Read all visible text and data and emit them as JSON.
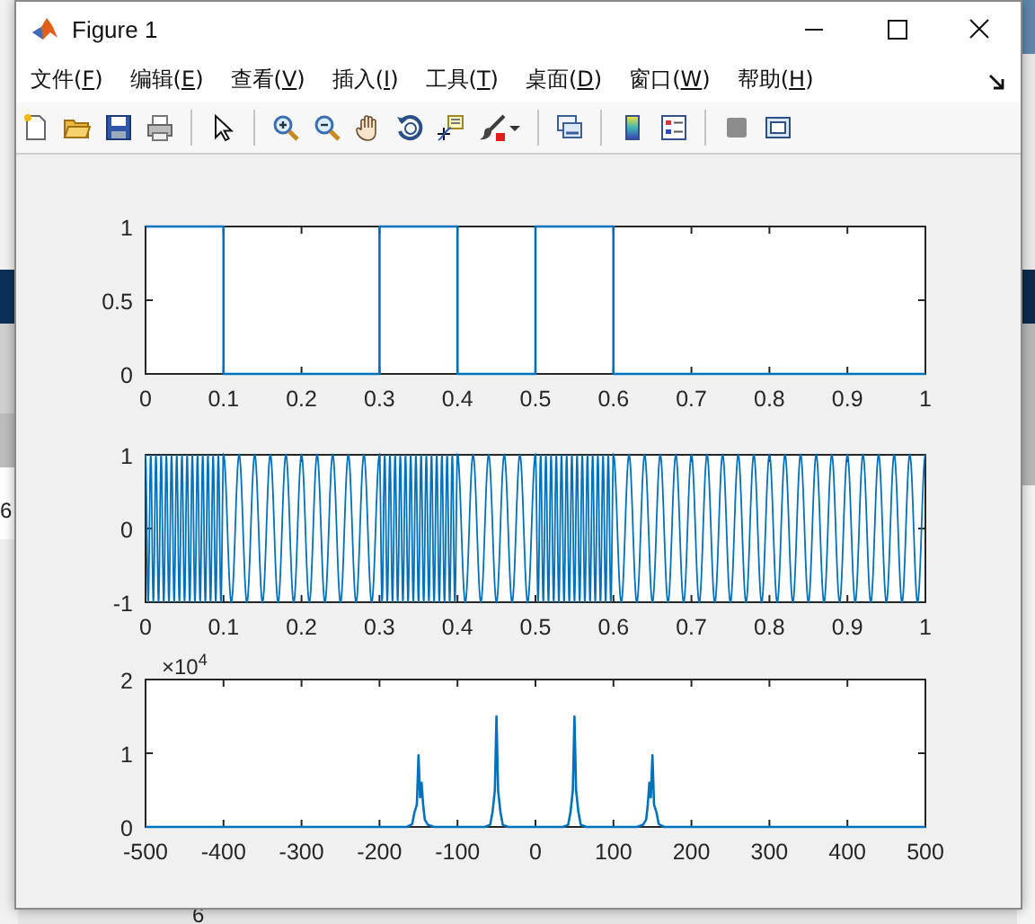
{
  "window": {
    "title": "Figure 1"
  },
  "menu": [
    {
      "parts": [
        {
          "text": "文件("
        },
        {
          "text": "F",
          "underlined": true
        },
        {
          "text": ")"
        }
      ]
    },
    {
      "parts": [
        {
          "text": "编辑("
        },
        {
          "text": "E",
          "underlined": true
        },
        {
          "text": ")"
        }
      ]
    },
    {
      "parts": [
        {
          "text": "查看("
        },
        {
          "text": "V",
          "underlined": true
        },
        {
          "text": ")"
        }
      ]
    },
    {
      "parts": [
        {
          "text": "插入("
        },
        {
          "text": "I",
          "underlined": true
        },
        {
          "text": ")"
        }
      ]
    },
    {
      "parts": [
        {
          "text": "工具("
        },
        {
          "text": "T",
          "underlined": true
        },
        {
          "text": ")"
        }
      ]
    },
    {
      "parts": [
        {
          "text": "桌面("
        },
        {
          "text": "D",
          "underlined": true
        },
        {
          "text": ")"
        }
      ]
    },
    {
      "parts": [
        {
          "text": "窗口("
        },
        {
          "text": "W",
          "underlined": true
        },
        {
          "text": ")"
        }
      ]
    },
    {
      "parts": [
        {
          "text": "帮助("
        },
        {
          "text": "H",
          "underlined": true
        },
        {
          "text": ")"
        }
      ]
    }
  ],
  "plots": [
    {
      "kind": "chart",
      "chart_data": {
        "type": "line",
        "xlim": [
          0,
          1
        ],
        "ylim": [
          0,
          1
        ],
        "xticks": [
          0,
          0.1,
          0.2,
          0.3,
          0.4,
          0.5,
          0.6,
          0.7,
          0.8,
          0.9,
          1
        ],
        "yticks": [
          0,
          0.5,
          1
        ],
        "x": [
          0,
          0.1,
          0.1,
          0.3,
          0.3,
          0.4,
          0.4,
          0.5,
          0.5,
          0.6,
          0.6,
          1
        ],
        "series": [
          {
            "color": "#0072bd",
            "values": [
              1,
              1,
              0,
              0,
              1,
              1,
              0,
              0,
              1,
              1,
              0,
              0
            ]
          }
        ]
      }
    },
    {
      "kind": "waveform",
      "xtick_labels": [
        "0",
        "0.1",
        "0.2",
        "0.3",
        "0.4",
        "0.5",
        "0.6",
        "0.7",
        "0.8",
        "0.9",
        "1"
      ],
      "ytick_labels": [
        "1",
        "0",
        "-1"
      ]
    },
    {
      "kind": "chart",
      "exponent": "×10$^{4}$",
      "chart_data": {
        "type": "line",
        "xlim": [
          -500,
          500
        ],
        "ylim": [
          0,
          2
        ],
        "xticks": [
          -500,
          -400,
          -300,
          -200,
          -100,
          0,
          100,
          200,
          300,
          400,
          500
        ],
        "yticks": [
          0,
          1,
          2
        ],
        "x": [
          -500,
          -165,
          -158,
          -155,
          -152,
          -150,
          -148,
          -146,
          -144,
          -142,
          -138,
          -130,
          -65,
          -58,
          -55,
          -52,
          -50,
          -48,
          -45,
          -42,
          -35,
          35,
          42,
          45,
          48,
          50,
          52,
          55,
          58,
          65,
          130,
          138,
          142,
          144,
          146,
          148,
          150,
          152,
          155,
          158,
          165,
          500
        ],
        "series": [
          {
            "color": "#0072bd",
            "values": [
              0,
              0,
              0.04,
              0.2,
              0.3,
              0.97,
              0.4,
              0.6,
              0.3,
              0.1,
              0.03,
              0,
              0,
              0.03,
              0.2,
              0.5,
              1.5,
              0.5,
              0.2,
              0.03,
              0,
              0,
              0.03,
              0.2,
              0.5,
              1.5,
              0.5,
              0.2,
              0.03,
              0,
              0,
              0.03,
              0.1,
              0.3,
              0.6,
              0.4,
              0.97,
              0.3,
              0.2,
              0.04,
              0,
              0
            ]
          }
        ]
      }
    }
  ],
  "background_texts": [
    "6",
    "6"
  ]
}
